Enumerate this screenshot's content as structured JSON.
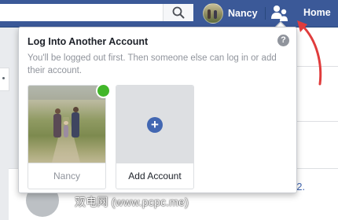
{
  "topbar": {
    "search_placeholder": "",
    "profile_name": "Nancy",
    "home_label": "Home"
  },
  "dropdown": {
    "title": "Log Into Another Account",
    "description": "You'll be logged out first. Then someone else can log in or add their account.",
    "help_symbol": "?",
    "accounts": [
      {
        "name": "Nancy",
        "online": true
      },
      {
        "name": "Add Account"
      }
    ],
    "add_symbol": "+"
  },
  "background": {
    "link_fragment": "22.",
    "watermark": "双电网 (www.pcpc.me)"
  },
  "colors": {
    "brand_blue": "#3b5998",
    "online_green": "#42b72a",
    "annotation_red": "#e03c3c"
  }
}
